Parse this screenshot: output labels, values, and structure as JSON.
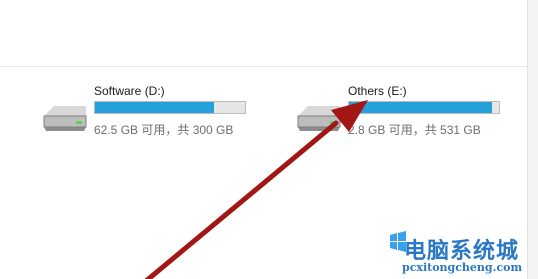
{
  "drives": [
    {
      "name": "Software (D:)",
      "space_text": "62.5 GB 可用，共 300 GB",
      "used_fraction": 0.79,
      "icon": "hard-drive-icon"
    },
    {
      "name": "Others (E:)",
      "space_text": "2.8 GB 可用，共 531 GB",
      "used_fraction": 0.95,
      "icon": "hard-drive-icon"
    }
  ],
  "annotation": {
    "icon": "red-arrow-icon",
    "color": "#a31616"
  },
  "watermark": {
    "title": "电脑系统城",
    "url": "pcxitongcheng.com",
    "color": "#2a78c4"
  },
  "colors": {
    "usage_bar_fill": "#26a0da",
    "usage_bar_track": "#e6e6e6"
  }
}
